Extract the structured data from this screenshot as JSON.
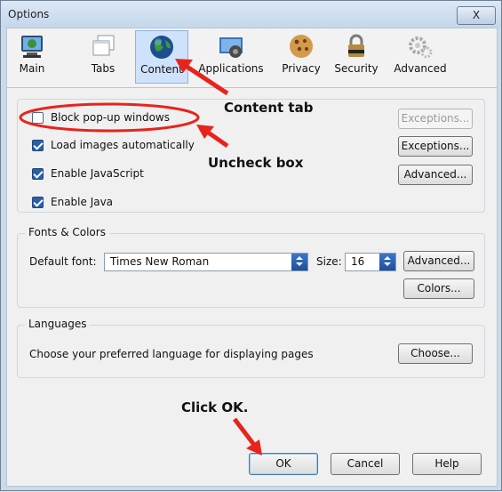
{
  "window": {
    "title": "Options",
    "close_glyph": "X"
  },
  "toolbar": {
    "tabs": [
      {
        "label": "Main",
        "icon": "monitor-icon"
      },
      {
        "label": "Tabs",
        "icon": "tabs-icon"
      },
      {
        "label": "Content",
        "icon": "globe-icon",
        "active": true
      },
      {
        "label": "Applications",
        "icon": "applications-icon"
      },
      {
        "label": "Privacy",
        "icon": "privacy-icon"
      },
      {
        "label": "Security",
        "icon": "lock-icon"
      },
      {
        "label": "Advanced",
        "icon": "gear-icon"
      }
    ]
  },
  "content": {
    "checkboxes": [
      {
        "label": "Block pop-up windows",
        "checked": false,
        "button": "Exceptions...",
        "button_enabled": false
      },
      {
        "label": "Load images automatically",
        "checked": true,
        "button": "Exceptions...",
        "button_enabled": true
      },
      {
        "label": "Enable JavaScript",
        "checked": true,
        "button": "Advanced...",
        "button_enabled": true
      },
      {
        "label": "Enable Java",
        "checked": true
      }
    ]
  },
  "fonts": {
    "legend": "Fonts & Colors",
    "default_font_label": "Default font:",
    "default_font_value": "Times New Roman",
    "size_label": "Size:",
    "size_value": "16",
    "advanced_button": "Advanced...",
    "colors_button": "Colors..."
  },
  "languages": {
    "legend": "Languages",
    "description": "Choose your preferred language for displaying pages",
    "choose_button": "Choose..."
  },
  "footer": {
    "ok": "OK",
    "cancel": "Cancel",
    "help": "Help"
  },
  "annotations": {
    "content_tab": "Content tab",
    "uncheck_box": "Uncheck box",
    "click_ok": "Click OK."
  },
  "colors": {
    "annotation_red": "#e8231c",
    "accent_blue": "#2a5fa8"
  }
}
